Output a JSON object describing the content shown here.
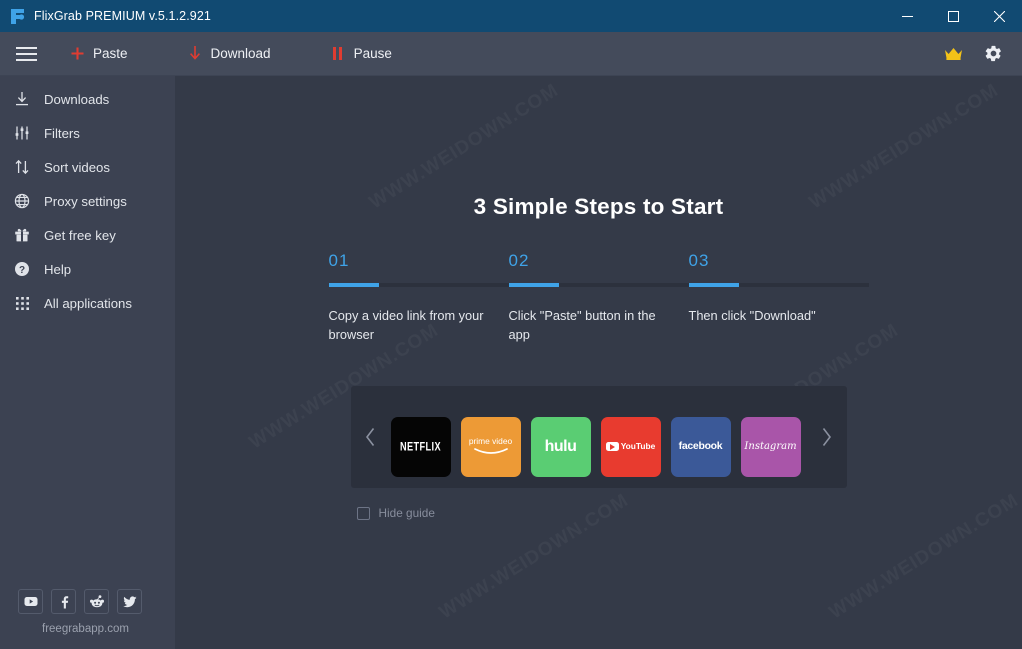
{
  "titlebar": {
    "logo_icon": "flixgrab-logo-icon",
    "title": "FlixGrab PREMIUM  v.5.1.2.921",
    "minimize_label": "–",
    "maximize_label": "☐",
    "close_label": "✕"
  },
  "toolbar": {
    "menu_icon": "hamburger-menu-icon",
    "actions": [
      {
        "label": "Paste",
        "icon": "plus-icon"
      },
      {
        "label": "Download",
        "icon": "download-arrow-icon"
      },
      {
        "label": "Pause",
        "icon": "pause-icon"
      }
    ],
    "premium_icon": "crown-icon",
    "settings_icon": "gear-icon",
    "accent_red": "#e03c31",
    "crown_color": "#f2c218"
  },
  "sidebar": {
    "items": [
      {
        "label": "Downloads",
        "icon": "download-icon"
      },
      {
        "label": "Filters",
        "icon": "filters-sliders-icon"
      },
      {
        "label": "Sort videos",
        "icon": "sort-arrows-icon"
      },
      {
        "label": "Proxy settings",
        "icon": "globe-icon"
      },
      {
        "label": "Get free key",
        "icon": "gift-icon"
      },
      {
        "label": "Help",
        "icon": "question-circle-icon"
      },
      {
        "label": "All applications",
        "icon": "grid-dots-icon"
      }
    ],
    "socials": [
      {
        "name": "youtube-icon",
        "label": "YouTube"
      },
      {
        "name": "facebook-icon",
        "label": "f"
      },
      {
        "name": "reddit-icon",
        "label": "Reddit"
      },
      {
        "name": "twitter-icon",
        "label": "Twitter"
      }
    ],
    "site": "freegrabapp.com"
  },
  "guide": {
    "title": "3 Simple Steps to Start",
    "steps": [
      {
        "number": "01",
        "text": "Copy a video link from your browser"
      },
      {
        "number": "02",
        "text": "Click \"Paste\" button in the app"
      },
      {
        "number": "03",
        "text": "Then click \"Download\""
      }
    ],
    "step_accent": "#3FA3E8",
    "hide_guide_label": "Hide guide",
    "hide_guide_checked": false
  },
  "carousel": {
    "prev_icon": "chevron-left-icon",
    "next_icon": "chevron-right-icon",
    "services": [
      {
        "name": "netflix",
        "label": "NETFLIX",
        "color": "#050505"
      },
      {
        "name": "prime-video",
        "label": "prime video",
        "color": "#ED9A36"
      },
      {
        "name": "hulu",
        "label": "hulu",
        "color": "#5ACD73"
      },
      {
        "name": "youtube",
        "label": "YouTube",
        "color": "#E83B2F"
      },
      {
        "name": "facebook",
        "label": "facebook",
        "color": "#3B5998"
      },
      {
        "name": "instagram",
        "label": "Instagram",
        "color": "#A955A9"
      },
      {
        "name": "next-service-partial",
        "label": "",
        "color": "#29C5F6"
      }
    ]
  },
  "watermarks": [
    "WWW.WEIDOWN.COM",
    "WWW.WEIDOWN.COM",
    "WWW.WEIDOWN.COM",
    "WWW.WEIDOWN.COM",
    "WWW.WEIDOWN.COM",
    "WWW.WEIDOWN.COM"
  ]
}
